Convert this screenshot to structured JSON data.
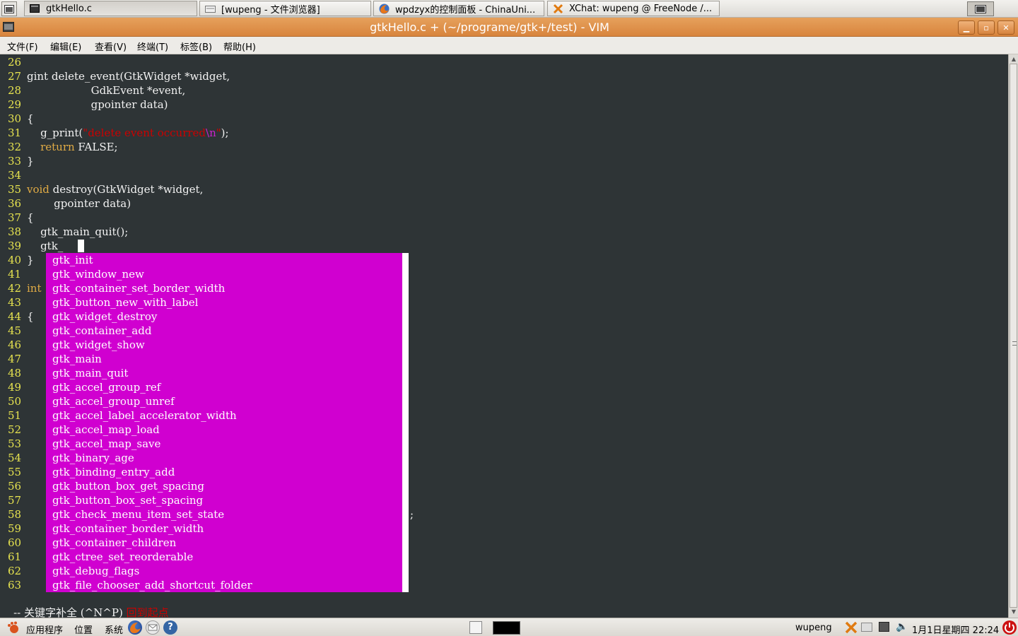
{
  "taskbar": {
    "tasks": [
      {
        "label": "gtkHello.c"
      },
      {
        "label": "[wupeng - 文件浏览器]"
      },
      {
        "label": "wpdzyx的控制面板 - ChinaUni..."
      },
      {
        "label": "XChat: wupeng @ FreeNode /..."
      }
    ]
  },
  "window": {
    "title": "gtkHello.c + (~/programe/gtk+/test) - VIM"
  },
  "menubar": {
    "items": [
      "文件(F)",
      "编辑(E)",
      "查看(V)",
      "终端(T)",
      "标签(B)",
      "帮助(H)"
    ]
  },
  "editor": {
    "lines": [
      {
        "n": "26",
        "text": ""
      },
      {
        "n": "27",
        "text": "gint delete_event(GtkWidget *widget,"
      },
      {
        "n": "28",
        "text": "                   GdkEvent *event,"
      },
      {
        "n": "29",
        "text": "                   gpointer data)"
      },
      {
        "n": "30",
        "text": "{"
      },
      {
        "n": "31",
        "text": "    g_print(\"delete event occurred\\n\");"
      },
      {
        "n": "32",
        "text": "    return FALSE;"
      },
      {
        "n": "33",
        "text": "}"
      },
      {
        "n": "34",
        "text": ""
      },
      {
        "n": "35",
        "text": "void destroy(GtkWidget *widget,"
      },
      {
        "n": "36",
        "text": "        gpointer data)"
      },
      {
        "n": "37",
        "text": "{"
      },
      {
        "n": "38",
        "text": "    gtk_main_quit();"
      },
      {
        "n": "39",
        "text": "    gtk_"
      },
      {
        "n": "40",
        "text": "}"
      },
      {
        "n": "41",
        "text": ""
      },
      {
        "n": "42",
        "text": "int"
      },
      {
        "n": "43",
        "text": ""
      },
      {
        "n": "44",
        "text": "{"
      },
      {
        "n": "45",
        "text": ""
      },
      {
        "n": "46",
        "text": ""
      },
      {
        "n": "47",
        "text": ""
      },
      {
        "n": "48",
        "text": ""
      },
      {
        "n": "49",
        "text": ""
      },
      {
        "n": "50",
        "text": ""
      },
      {
        "n": "51",
        "text": ""
      },
      {
        "n": "52",
        "text": ""
      },
      {
        "n": "53",
        "text": ""
      },
      {
        "n": "54",
        "text": ""
      },
      {
        "n": "55",
        "text": ""
      },
      {
        "n": "56",
        "text": ""
      },
      {
        "n": "57",
        "text": ""
      },
      {
        "n": "58",
        "text": ""
      },
      {
        "n": "59",
        "text": ""
      },
      {
        "n": "60",
        "text": ""
      },
      {
        "n": "61",
        "text": ""
      },
      {
        "n": "62",
        "text": ""
      },
      {
        "n": "63",
        "text": ""
      }
    ],
    "line31": {
      "prefix": "    g_print(",
      "quote_open": "\"",
      "string": "delete event occurred",
      "escape": "\\n",
      "quote_close": "\"",
      "suffix": ");"
    },
    "line32": {
      "keyword": "return",
      "rest": " FALSE;"
    },
    "line35": {
      "keyword": "void",
      "rest": " destroy(GtkWidget *widget,"
    },
    "line42": {
      "keyword": "int"
    },
    "line58_tail": ";",
    "completions": [
      "gtk_init",
      "gtk_window_new",
      "gtk_container_set_border_width",
      "gtk_button_new_with_label",
      "gtk_widget_destroy",
      "gtk_container_add",
      "gtk_widget_show",
      "gtk_main",
      "gtk_main_quit",
      "gtk_accel_group_ref",
      "gtk_accel_group_unref",
      "gtk_accel_label_accelerator_width",
      "gtk_accel_map_load",
      "gtk_accel_map_save",
      "gtk_binary_age",
      "gtk_binding_entry_add",
      "gtk_button_box_get_spacing",
      "gtk_button_box_set_spacing",
      "gtk_check_menu_item_set_state",
      "gtk_container_border_width",
      "gtk_container_children",
      "gtk_ctree_set_reorderable",
      "gtk_debug_flags",
      "gtk_file_chooser_add_shortcut_folder"
    ],
    "status_mode": "-- 关键字补全 (^N^P) ",
    "status_msg": "回到起点"
  },
  "panel": {
    "apps": "应用程序",
    "places": "位置",
    "system": "系统",
    "user": "wupeng",
    "clock": "1月1日星期四  22:24"
  },
  "colors": {
    "editor_bg": "#2e3436",
    "line_number": "#e6e34f",
    "keyword": "#e0ab45",
    "string": "#cc0000",
    "popup": "#d000d0",
    "titlebar": "#d8843d"
  }
}
